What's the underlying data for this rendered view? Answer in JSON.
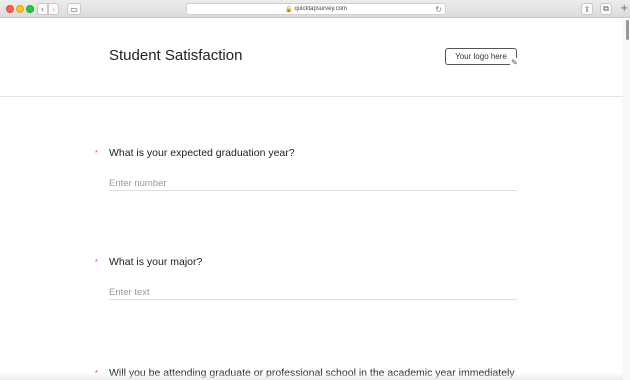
{
  "browser": {
    "url": "quicktapsurvey.com",
    "lock_icon": "lock-icon",
    "reload_icon": "reload-icon"
  },
  "survey": {
    "title": "Student Satisfaction",
    "logo_placeholder": "Your logo here"
  },
  "questions": [
    {
      "required_marker": "*",
      "text": "What is your expected graduation year?",
      "placeholder": "Enter number"
    },
    {
      "required_marker": "*",
      "text": "What is your major?",
      "placeholder": "Enter text"
    },
    {
      "required_marker": "*",
      "text": "Will you be attending graduate or professional school in the academic year immediately"
    }
  ]
}
